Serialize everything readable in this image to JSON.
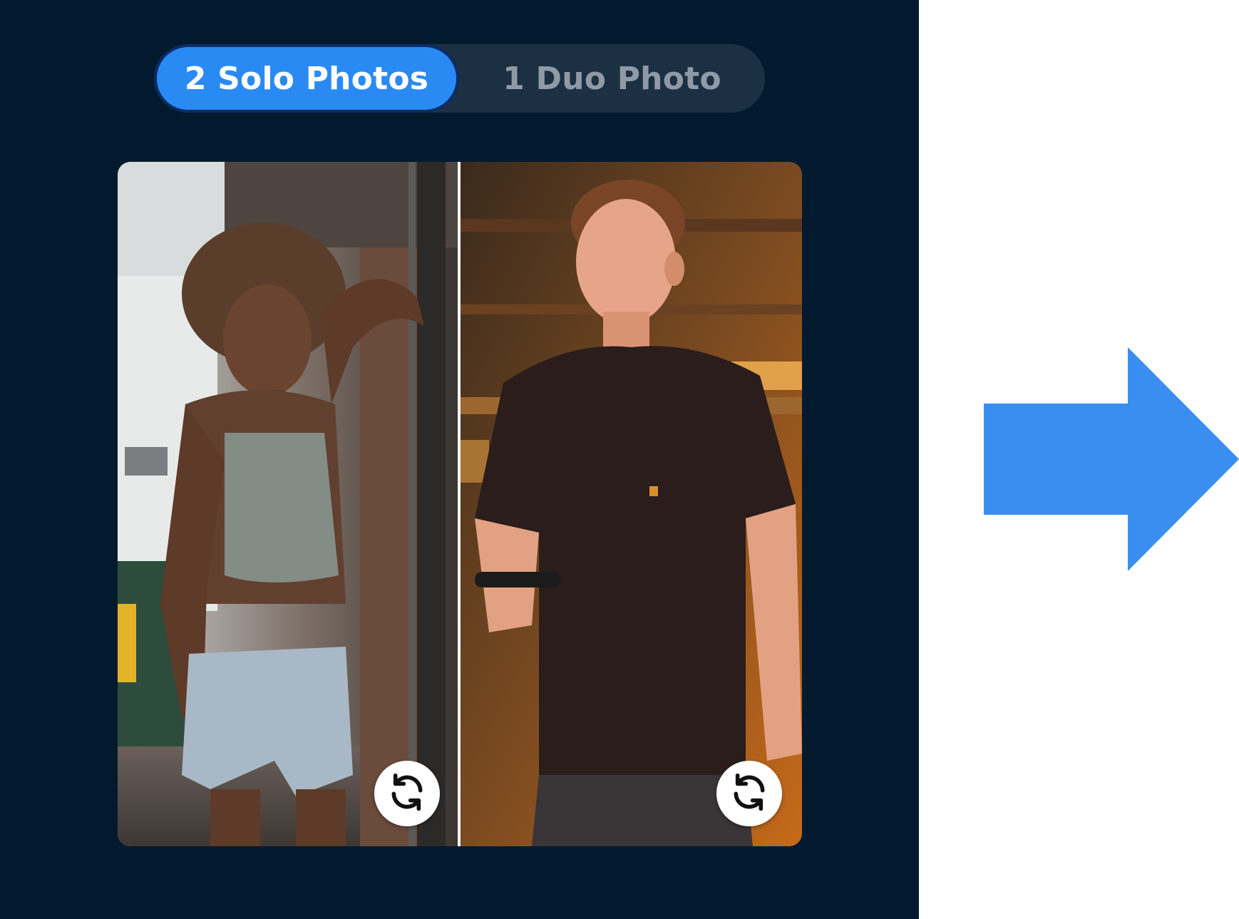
{
  "segmented_control": {
    "options": [
      {
        "label": "2 Solo Photos",
        "selected": true
      },
      {
        "label": "1 Duo Photo",
        "selected": false
      }
    ]
  },
  "photos": [
    {
      "subject": "woman-in-tank-top-photo",
      "swap_icon": "refresh-icon"
    },
    {
      "subject": "man-in-black-tshirt-photo",
      "swap_icon": "refresh-icon"
    }
  ],
  "arrow_icon": "right-arrow-icon",
  "colors": {
    "panel_bg": "#031a2e",
    "accent": "#2a8af4",
    "segment_bg": "#1c3044",
    "inactive_text": "#8f9aa6",
    "arrow": "#3a8ef0"
  }
}
